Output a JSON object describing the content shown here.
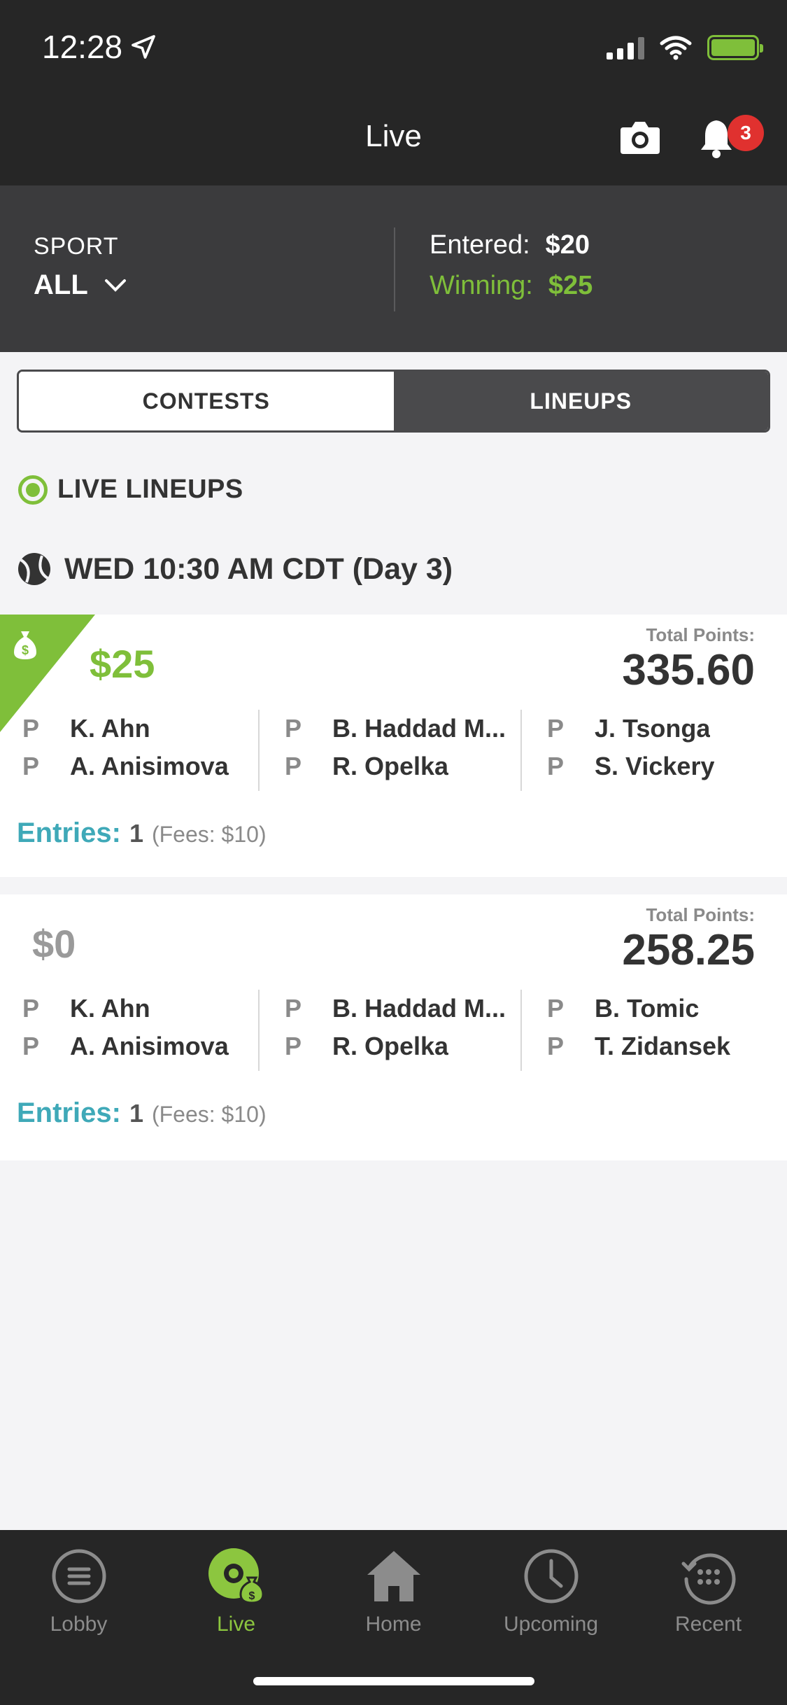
{
  "status_bar": {
    "time": "12:28"
  },
  "header": {
    "title": "Live",
    "notification_count": "3"
  },
  "summary": {
    "sport_label": "SPORT",
    "sport_value": "ALL",
    "entered_label": "Entered:",
    "entered_value": "$20",
    "winning_label": "Winning:",
    "winning_value": "$25"
  },
  "tabs": {
    "contests": "CONTESTS",
    "lineups": "LINEUPS",
    "active": "LINEUPS"
  },
  "section": {
    "title": "LIVE LINEUPS"
  },
  "date_group": {
    "title": "WED 10:30 AM CDT  (Day 3)"
  },
  "lineups": [
    {
      "winnings": "$25",
      "total_points_label": "Total Points:",
      "total_points": "335.60",
      "players": [
        [
          "P",
          "K. Ahn"
        ],
        [
          "P",
          "A. Anisimova"
        ],
        [
          "P",
          "B. Haddad M..."
        ],
        [
          "P",
          "R. Opelka"
        ],
        [
          "P",
          "J. Tsonga"
        ],
        [
          "P",
          "S. Vickery"
        ]
      ],
      "entries_label": "Entries:",
      "entries_count": "1",
      "fees": "(Fees: $10)"
    },
    {
      "winnings": "$0",
      "total_points_label": "Total Points:",
      "total_points": "258.25",
      "players": [
        [
          "P",
          "K. Ahn"
        ],
        [
          "P",
          "A. Anisimova"
        ],
        [
          "P",
          "B. Haddad M..."
        ],
        [
          "P",
          "R. Opelka"
        ],
        [
          "P",
          "B. Tomic"
        ],
        [
          "P",
          "T. Zidansek"
        ]
      ],
      "entries_label": "Entries:",
      "entries_count": "1",
      "fees": "(Fees: $10)"
    }
  ],
  "tab_bar": {
    "items": [
      {
        "label": "Lobby",
        "icon": "menu-circle-icon"
      },
      {
        "label": "Live",
        "icon": "live-money-icon"
      },
      {
        "label": "Home",
        "icon": "home-icon"
      },
      {
        "label": "Upcoming",
        "icon": "clock-icon"
      },
      {
        "label": "Recent",
        "icon": "history-icon"
      }
    ],
    "active": "Live"
  },
  "colors": {
    "accent_green": "#7fbf3a",
    "entries_teal": "#3fa9b8",
    "badge_red": "#e0312f"
  }
}
